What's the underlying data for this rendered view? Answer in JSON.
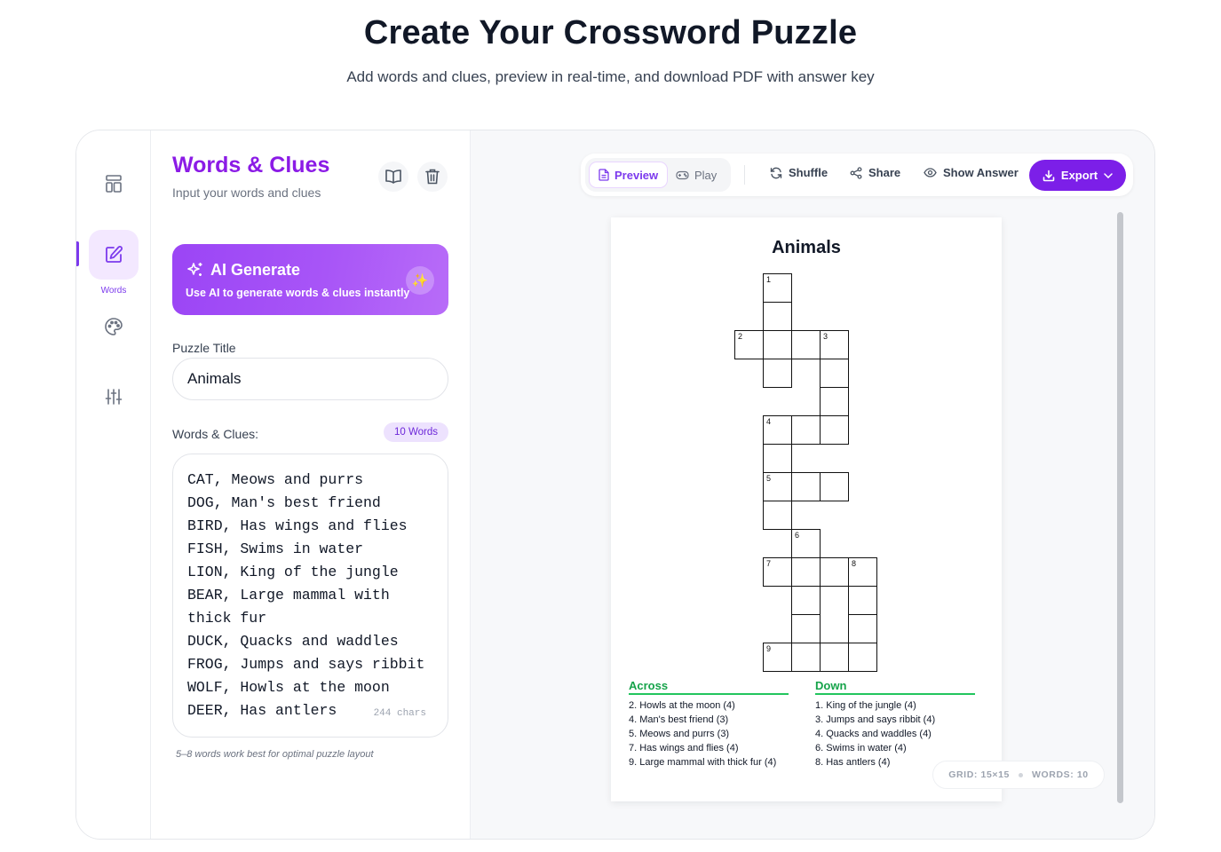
{
  "header": {
    "title": "Create Your Crossword Puzzle",
    "subtitle": "Add words and clues, preview in real-time, and download PDF with answer key"
  },
  "rail": {
    "items": [
      {
        "icon": "layout-icon",
        "label": ""
      },
      {
        "icon": "edit-icon",
        "label": "Words"
      },
      {
        "icon": "palette-icon",
        "label": ""
      },
      {
        "icon": "sliders-icon",
        "label": ""
      }
    ]
  },
  "editor": {
    "title": "Words & Clues",
    "subtitle": "Input your words and clues",
    "ai": {
      "title": "AI Generate",
      "subtitle": "Use AI to generate words & clues instantly",
      "badge": "✨"
    },
    "puzzle_title_label": "Puzzle Title",
    "puzzle_title_value": "Animals",
    "words_label": "Words & Clues:",
    "word_count": "10 Words",
    "lines": [
      "CAT, Meows and purrs",
      "DOG, Man's best friend",
      "BIRD, Has wings and flies",
      "FISH, Swims in water",
      "LION, King of the jungle",
      "BEAR, Large mammal with",
      "thick fur",
      "DUCK, Quacks and waddles",
      "FROG, Jumps and says ribbit",
      "WOLF, Howls at the moon",
      "DEER, Has antlers"
    ],
    "char_count": "244 chars",
    "hint": "5–8 words work best for optimal puzzle layout"
  },
  "toolbar": {
    "preview": "Preview",
    "play": "Play",
    "shuffle": "Shuffle",
    "share": "Share",
    "show_answer": "Show Answer",
    "export": "Export"
  },
  "puzzle": {
    "title": "Animals",
    "across_heading": "Across",
    "down_heading": "Down",
    "across": [
      "2. Howls at the moon (4)",
      "4. Man's best friend (3)",
      "5. Meows and purrs (3)",
      "7. Has wings and flies (4)",
      "9. Large mammal with thick fur (4)"
    ],
    "down": [
      "1. King of the jungle (4)",
      "3. Jumps and says ribbit (4)",
      "4. Quacks and waddles (4)",
      "6. Swims in water (4)",
      "8. Has antlers (4)"
    ],
    "cells": [
      {
        "r": 0,
        "c": 1,
        "n": "1"
      },
      {
        "r": 1,
        "c": 1
      },
      {
        "r": 2,
        "c": 0,
        "n": "2"
      },
      {
        "r": 2,
        "c": 1
      },
      {
        "r": 2,
        "c": 2
      },
      {
        "r": 2,
        "c": 3,
        "n": "3"
      },
      {
        "r": 3,
        "c": 1
      },
      {
        "r": 3,
        "c": 3
      },
      {
        "r": 4,
        "c": 3
      },
      {
        "r": 5,
        "c": 1,
        "n": "4"
      },
      {
        "r": 5,
        "c": 2
      },
      {
        "r": 5,
        "c": 3
      },
      {
        "r": 6,
        "c": 1
      },
      {
        "r": 7,
        "c": 1,
        "n": "5"
      },
      {
        "r": 7,
        "c": 2
      },
      {
        "r": 7,
        "c": 3
      },
      {
        "r": 8,
        "c": 1
      },
      {
        "r": 9,
        "c": 2,
        "n": "6"
      },
      {
        "r": 10,
        "c": 1,
        "n": "7"
      },
      {
        "r": 10,
        "c": 2
      },
      {
        "r": 10,
        "c": 3
      },
      {
        "r": 10,
        "c": 4,
        "n": "8"
      },
      {
        "r": 11,
        "c": 2
      },
      {
        "r": 11,
        "c": 4
      },
      {
        "r": 12,
        "c": 2
      },
      {
        "r": 12,
        "c": 4
      },
      {
        "r": 13,
        "c": 1,
        "n": "9"
      },
      {
        "r": 13,
        "c": 2
      },
      {
        "r": 13,
        "c": 3
      },
      {
        "r": 13,
        "c": 4
      }
    ]
  },
  "status": {
    "grid": "GRID: 15×15",
    "words": "WORDS: 10"
  },
  "colors": {
    "accent": "#7c3aed",
    "export": "#7c1fe8",
    "clue_heading": "#16a34a"
  }
}
